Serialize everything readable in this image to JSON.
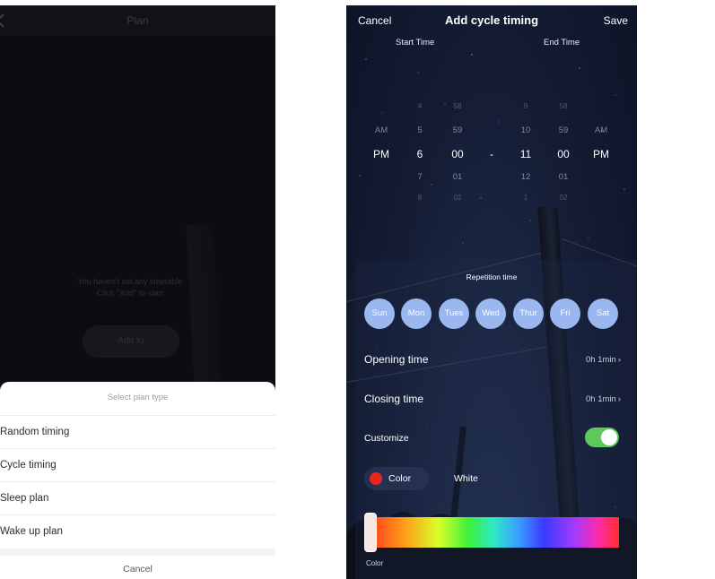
{
  "left": {
    "nav": {
      "title": "Plan"
    },
    "empty_state": {
      "line1": "You haven't set any timetable",
      "line2": "Click \"Add\" to start"
    },
    "add_button": "Add to",
    "sheet": {
      "title": "Select plan type",
      "options": [
        "Random timing",
        "Cycle timing",
        "Sleep plan",
        "Wake up plan"
      ],
      "cancel": "Cancel"
    }
  },
  "right": {
    "nav": {
      "cancel": "Cancel",
      "title": "Add cycle timing",
      "save": "Save"
    },
    "picker": {
      "start_label": "Start Time",
      "end_label": "End Time",
      "start_ampm": [
        "AM",
        "PM"
      ],
      "start_hour": [
        "4",
        "5",
        "6",
        "7",
        "8"
      ],
      "start_minute": [
        "58",
        "59",
        "00",
        "01",
        "02"
      ],
      "separator": "-",
      "end_hour": [
        "9",
        "10",
        "11",
        "12",
        "1"
      ],
      "end_minute": [
        "58",
        "59",
        "00",
        "01",
        "02"
      ],
      "end_ampm": [
        "AM",
        "PM"
      ]
    },
    "repetition": {
      "title": "Repetition time",
      "days": [
        "Sun",
        "Mon",
        "Tues",
        "Wed",
        "Thur",
        "Fri",
        "Sat"
      ]
    },
    "opening": {
      "label": "Opening time",
      "value": "0h 1min"
    },
    "closing": {
      "label": "Closing time",
      "value": "0h 1min"
    },
    "customize": {
      "label": "Customize",
      "enabled": true
    },
    "color": {
      "chip_label": "Color",
      "name": "White",
      "dot_color": "#e8261d",
      "caption": "Color"
    },
    "accent_color": "#5cc95a",
    "day_color": "#9bb7f0"
  }
}
